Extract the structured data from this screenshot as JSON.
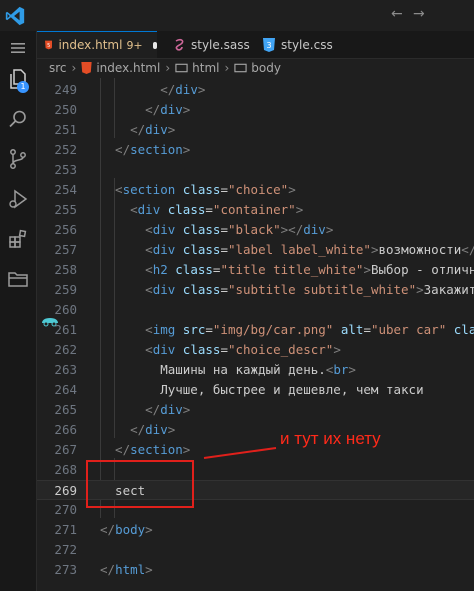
{
  "titlebar": {
    "back": "←",
    "forward": "→"
  },
  "activity": {
    "explorer_badge": "1"
  },
  "tabs": [
    {
      "label": "index.html",
      "modified": "9+",
      "active": true
    },
    {
      "label": "style.sass",
      "active": false
    },
    {
      "label": "style.css",
      "active": false
    }
  ],
  "breadcrumb": [
    "src",
    "index.html",
    "html",
    "body"
  ],
  "lines": [
    {
      "n": "249",
      "code": [
        [
          "t",
          "        </"
        ],
        [
          "tg",
          "div"
        ],
        [
          "t",
          ">"
        ]
      ]
    },
    {
      "n": "250",
      "code": [
        [
          "t",
          "      </"
        ],
        [
          "tg",
          "div"
        ],
        [
          "t",
          ">"
        ]
      ]
    },
    {
      "n": "251",
      "code": [
        [
          "t",
          "    </"
        ],
        [
          "tg",
          "div"
        ],
        [
          "t",
          ">"
        ]
      ]
    },
    {
      "n": "252",
      "code": [
        [
          "t",
          "  </"
        ],
        [
          "tg",
          "section"
        ],
        [
          "t",
          ">"
        ]
      ]
    },
    {
      "n": "253",
      "code": []
    },
    {
      "n": "254",
      "code": [
        [
          "t",
          "  <"
        ],
        [
          "tg",
          "section"
        ],
        [
          "tx",
          " "
        ],
        [
          "at",
          "class"
        ],
        [
          "tx",
          "="
        ],
        [
          "st",
          "\"choice\""
        ],
        [
          "t",
          ">"
        ]
      ]
    },
    {
      "n": "255",
      "code": [
        [
          "t",
          "    <"
        ],
        [
          "tg",
          "div"
        ],
        [
          "tx",
          " "
        ],
        [
          "at",
          "class"
        ],
        [
          "tx",
          "="
        ],
        [
          "st",
          "\"container\""
        ],
        [
          "t",
          ">"
        ]
      ]
    },
    {
      "n": "256",
      "code": [
        [
          "t",
          "      <"
        ],
        [
          "tg",
          "div"
        ],
        [
          "tx",
          " "
        ],
        [
          "at",
          "class"
        ],
        [
          "tx",
          "="
        ],
        [
          "st",
          "\"black\""
        ],
        [
          "t",
          "></"
        ],
        [
          "tg",
          "div"
        ],
        [
          "t",
          ">"
        ]
      ]
    },
    {
      "n": "257",
      "code": [
        [
          "t",
          "      <"
        ],
        [
          "tg",
          "div"
        ],
        [
          "tx",
          " "
        ],
        [
          "at",
          "class"
        ],
        [
          "tx",
          "="
        ],
        [
          "st",
          "\"label label_white\""
        ],
        [
          "t",
          ">"
        ],
        [
          "tx",
          "возможности"
        ],
        [
          "t",
          "</"
        ],
        [
          "tg",
          "d"
        ]
      ]
    },
    {
      "n": "258",
      "code": [
        [
          "t",
          "      <"
        ],
        [
          "tg",
          "h2"
        ],
        [
          "tx",
          " "
        ],
        [
          "at",
          "class"
        ],
        [
          "tx",
          "="
        ],
        [
          "st",
          "\"title title_white\""
        ],
        [
          "t",
          ">"
        ],
        [
          "tx",
          "Выбор - отличная"
        ]
      ]
    },
    {
      "n": "259",
      "code": [
        [
          "t",
          "      <"
        ],
        [
          "tg",
          "div"
        ],
        [
          "tx",
          " "
        ],
        [
          "at",
          "class"
        ],
        [
          "tx",
          "="
        ],
        [
          "st",
          "\"subtitle subtitle_white\""
        ],
        [
          "t",
          ">"
        ],
        [
          "tx",
          "Закажите"
        ]
      ]
    },
    {
      "n": "260",
      "code": []
    },
    {
      "n": "261",
      "code": [
        [
          "t",
          "      <"
        ],
        [
          "tg",
          "img"
        ],
        [
          "tx",
          " "
        ],
        [
          "at",
          "src"
        ],
        [
          "tx",
          "="
        ],
        [
          "st",
          "\"img/bg/car.png\""
        ],
        [
          "tx",
          " "
        ],
        [
          "at",
          "alt"
        ],
        [
          "tx",
          "="
        ],
        [
          "st",
          "\"uber car\""
        ],
        [
          "tx",
          " "
        ],
        [
          "at",
          "class"
        ]
      ]
    },
    {
      "n": "262",
      "code": [
        [
          "t",
          "      <"
        ],
        [
          "tg",
          "div"
        ],
        [
          "tx",
          " "
        ],
        [
          "at",
          "class"
        ],
        [
          "tx",
          "="
        ],
        [
          "st",
          "\"choice_descr\""
        ],
        [
          "t",
          ">"
        ]
      ]
    },
    {
      "n": "263",
      "code": [
        [
          "tx",
          "        Машины на каждый день."
        ],
        [
          "t",
          "<"
        ],
        [
          "tg",
          "br"
        ],
        [
          "t",
          ">"
        ]
      ]
    },
    {
      "n": "264",
      "code": [
        [
          "tx",
          "        Лучше, быстрее и дешевле, чем такси"
        ]
      ]
    },
    {
      "n": "265",
      "code": [
        [
          "t",
          "      </"
        ],
        [
          "tg",
          "div"
        ],
        [
          "t",
          ">"
        ]
      ]
    },
    {
      "n": "266",
      "code": [
        [
          "t",
          "    </"
        ],
        [
          "tg",
          "div"
        ],
        [
          "t",
          ">"
        ]
      ]
    },
    {
      "n": "267",
      "code": [
        [
          "t",
          "  </"
        ],
        [
          "tg",
          "section"
        ],
        [
          "t",
          ">"
        ]
      ]
    },
    {
      "n": "268",
      "code": []
    },
    {
      "n": "269",
      "code": [
        [
          "tx",
          "  sect"
        ]
      ],
      "current": true
    },
    {
      "n": "270",
      "code": []
    },
    {
      "n": "271",
      "code": [
        [
          "t",
          "</"
        ],
        [
          "tg",
          "body"
        ],
        [
          "t",
          ">"
        ]
      ]
    },
    {
      "n": "272",
      "code": []
    },
    {
      "n": "273",
      "code": [
        [
          "t",
          "</"
        ],
        [
          "tg",
          "html"
        ],
        [
          "t",
          ">"
        ]
      ]
    }
  ],
  "annotation": {
    "text": "и тут их нету",
    "color": "#ff2a1a"
  },
  "colors": {
    "tag": "#569cd6",
    "attr": "#9cdcfe",
    "string": "#ce9178",
    "punct": "#808080",
    "accent": "#0078d4"
  }
}
